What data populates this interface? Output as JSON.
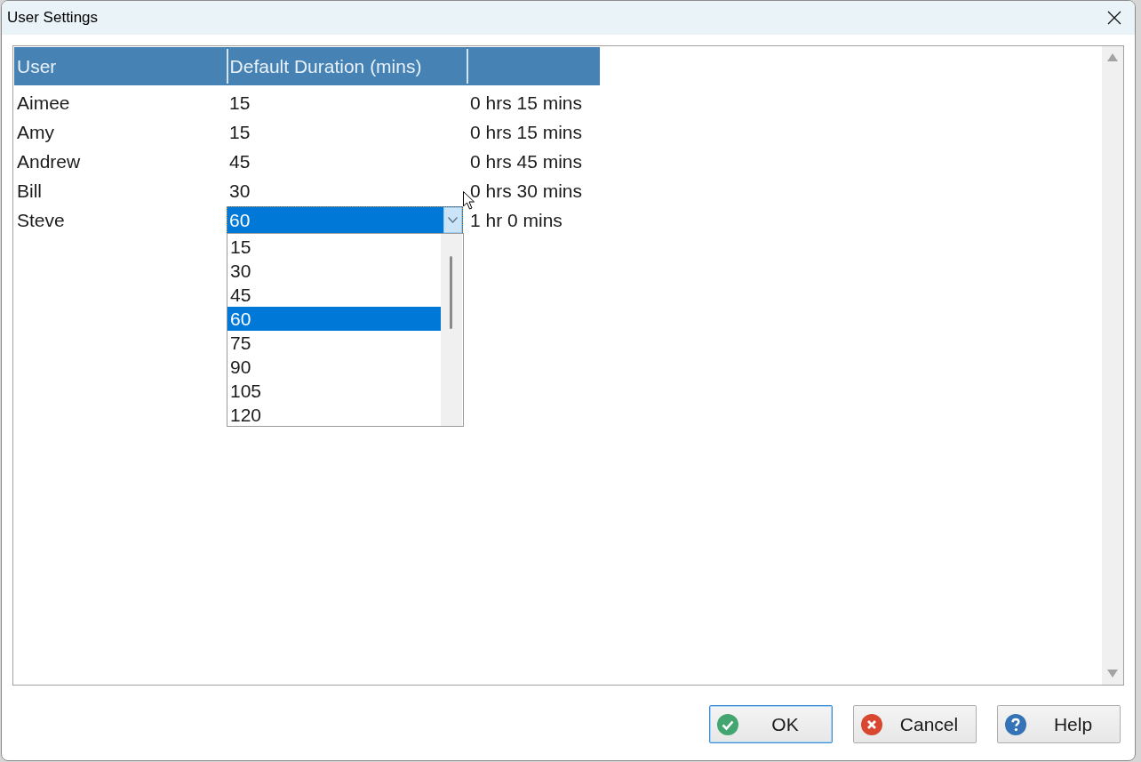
{
  "window": {
    "title": "User Settings"
  },
  "table": {
    "columns": [
      "User",
      "Default Duration (mins)"
    ],
    "rows": [
      {
        "user": "Aimee",
        "default_duration": "15",
        "column_3": "0 hrs 15 mins",
        "editing": false
      },
      {
        "user": "Amy",
        "default_duration": "15",
        "column_3": "0 hrs 15 mins",
        "editing": false
      },
      {
        "user": "Andrew",
        "default_duration": "45",
        "column_3": "0 hrs 45 mins",
        "editing": false
      },
      {
        "user": "Bill",
        "default_duration": "30",
        "column_3": "0 hrs 30 mins",
        "editing": false
      },
      {
        "user": "Steve",
        "default_duration": "60",
        "column_3": "1 hr 0 mins",
        "editing": true
      }
    ],
    "dropdown": {
      "expanded": true,
      "options": [
        {
          "label": "15",
          "selected": false
        },
        {
          "label": "30",
          "selected": false
        },
        {
          "label": "45",
          "selected": false
        },
        {
          "label": "60",
          "selected": true
        },
        {
          "label": "75",
          "selected": false
        },
        {
          "label": "90",
          "selected": false
        },
        {
          "label": "105",
          "selected": false
        },
        {
          "label": "120",
          "selected": false
        }
      ]
    }
  },
  "buttons": [
    {
      "label": "OK",
      "kind": "ok",
      "default": true
    },
    {
      "label": "Cancel",
      "kind": "cancel",
      "default": false
    },
    {
      "label": "Help",
      "kind": "help",
      "default": false
    }
  ]
}
